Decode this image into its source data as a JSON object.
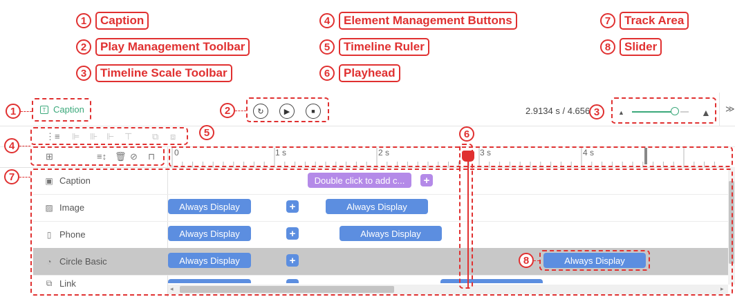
{
  "legend": [
    {
      "num": "1",
      "label": "Caption"
    },
    {
      "num": "2",
      "label": "Play Management Toolbar"
    },
    {
      "num": "3",
      "label": "Timeline Scale Toolbar"
    },
    {
      "num": "4",
      "label": "Element Management Buttons"
    },
    {
      "num": "5",
      "label": "Timeline Ruler"
    },
    {
      "num": "6",
      "label": "Playhead"
    },
    {
      "num": "7",
      "label": "Track Area"
    },
    {
      "num": "8",
      "label": "Slider"
    }
  ],
  "toolbar": {
    "caption_label": "Caption",
    "time_display": "2.9134 s / 4.6567"
  },
  "ruler": {
    "ticks": [
      "0",
      "1 s",
      "2 s",
      "3 s",
      "4 s"
    ]
  },
  "tracks": [
    {
      "name": "Caption",
      "icon": "text-frame-icon"
    },
    {
      "name": "Image",
      "icon": "image-icon"
    },
    {
      "name": "Phone",
      "icon": "phone-icon"
    },
    {
      "name": "Circle Basic",
      "icon": "shape-icon"
    },
    {
      "name": "Link",
      "icon": "link-icon"
    }
  ],
  "bars": {
    "caption_bar": "Double click to add c...",
    "image_bar_1": "Always Display",
    "image_bar_2": "Always Display",
    "phone_bar_1": "Always Display",
    "phone_bar_2": "Always Display",
    "circle_bar_1": "Always Display",
    "circle_bar_2": "Always Display",
    "plus": "+"
  },
  "callouts": {
    "c1": "1",
    "c2": "2",
    "c3": "3",
    "c4": "4",
    "c5": "5",
    "c6": "6",
    "c7": "7",
    "c8": "8"
  },
  "colors": {
    "annotation": "#e03030",
    "bar_blue": "#5c8ee0",
    "bar_purple": "#b48ae8",
    "caption_green": "#3aa87a",
    "selected_row": "#c8c8c8"
  },
  "playhead": {
    "time_seconds": 2.9134,
    "total_seconds": 4.6567
  }
}
